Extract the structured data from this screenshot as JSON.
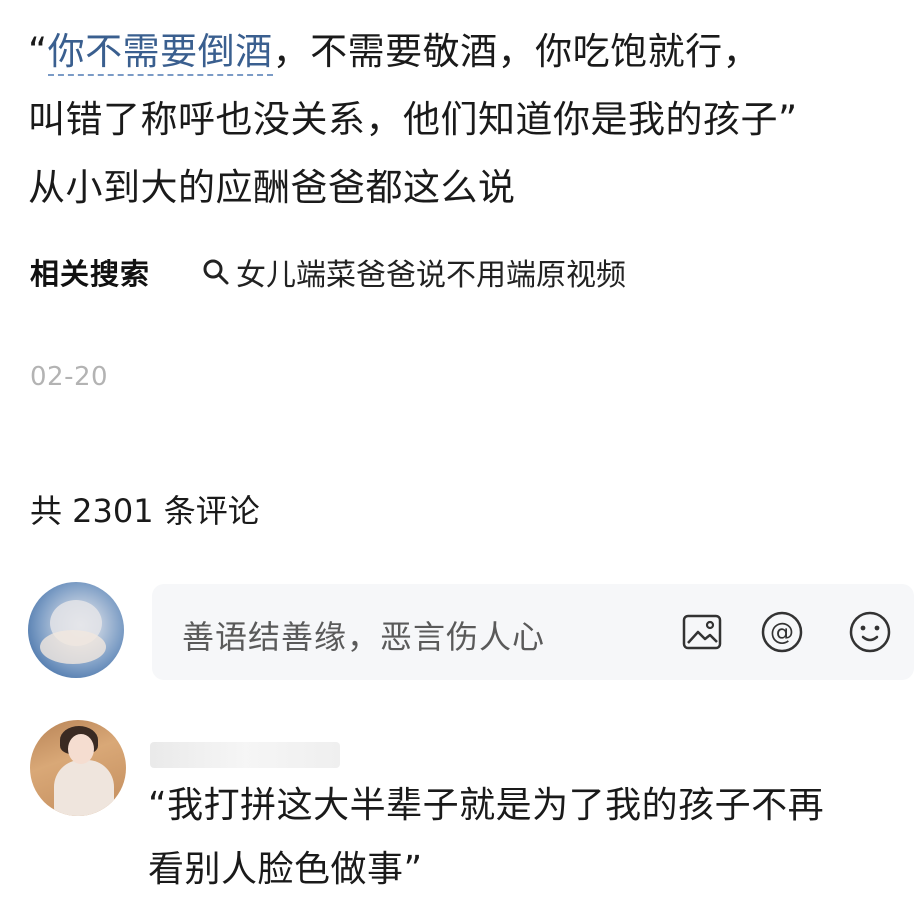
{
  "post": {
    "open_quote": "“",
    "search_link": "你不需要倒酒",
    "text_rest_line1": "，不需要敬酒，你吃饱就行，",
    "text_line2": "叫错了称呼也没关系，他们知道你是我的孩子”",
    "text_line3": "从小到大的应酬爸爸都这么说"
  },
  "related": {
    "title": "相关搜索",
    "icon": "search-icon",
    "query": "女儿端菜爸爸说不用端原视频"
  },
  "date": "02-20",
  "comments": {
    "count_label": "共 2301 条评论",
    "input_placeholder": "善语结善缘，恶言伤人心",
    "input_icons": [
      "image-icon",
      "at-icon",
      "emoji-icon"
    ],
    "list": [
      {
        "text_line1": "“我打拼这大半辈子就是为了我的孩子不再",
        "text_line2": "看别人脸色做事”"
      }
    ]
  },
  "colors": {
    "link": "#3a5f8f",
    "date": "#b3b3b3",
    "input_bg": "#f6f7f9"
  }
}
